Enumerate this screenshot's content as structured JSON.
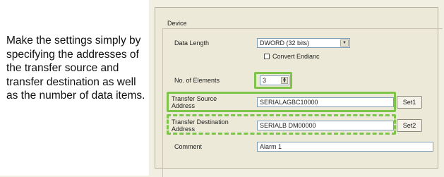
{
  "callout": {
    "text": "Make the settings simply by specifying the addresses of the transfer source and transfer destination as well as the number of data items."
  },
  "panel": {
    "group_title": "Device",
    "data_length_label": "Data Length",
    "data_length_value": "DWORD (32 bits)",
    "convert_endian_label": "Convert Endianc",
    "no_of_elements_label": "No. of Elements",
    "no_of_elements_value": "3",
    "transfer_source_label_1": "Transfer Source",
    "transfer_source_label_2": "Address",
    "transfer_source_value": "SERIALAGBC10000",
    "transfer_dest_label_1": "Transfer Destination",
    "transfer_dest_label_2": "Address",
    "transfer_dest_value": "SERIALB DM00000",
    "set1_label": "Set1",
    "set2_label": "Set2",
    "comment_label": "Comment",
    "comment_value": "Alarm 1"
  },
  "colors": {
    "highlight": "#7ec44a",
    "background": "#f1efe2"
  }
}
